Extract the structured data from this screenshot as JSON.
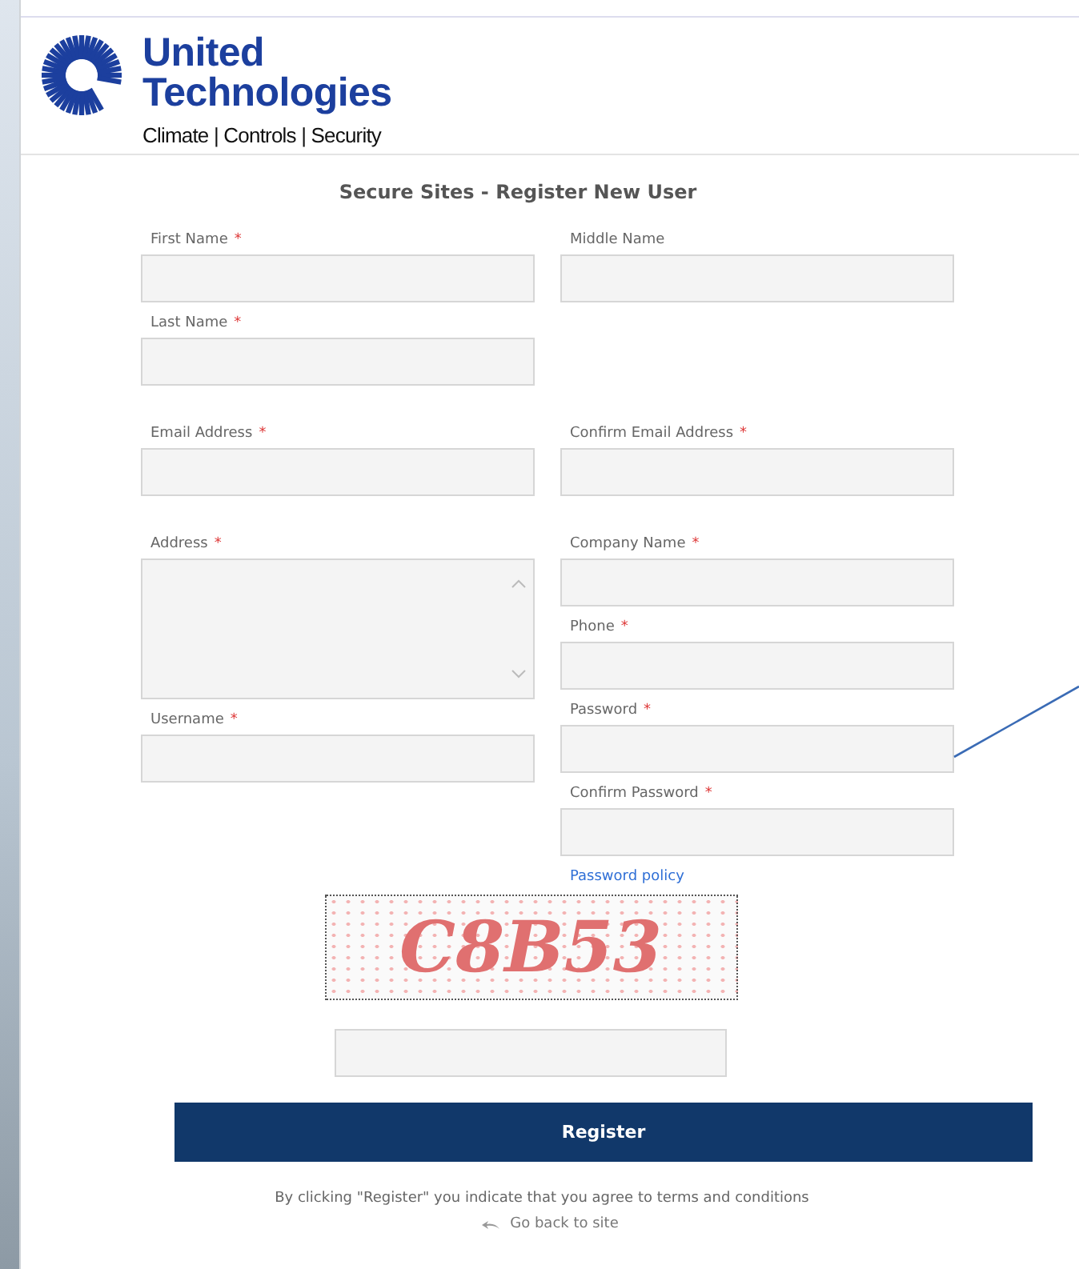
{
  "header": {
    "brand_line_1": "United",
    "brand_line_2": "Technologies",
    "tagline": "Climate | Controls | Security"
  },
  "form": {
    "title": "Secure Sites - Register New User",
    "sections": [
      {
        "left": [
          {
            "label": "First Name",
            "required_mark": "*",
            "kind": "text"
          },
          {
            "label": "Last Name",
            "required_mark": "*",
            "kind": "text"
          }
        ],
        "right": [
          {
            "label": "Middle Name",
            "kind": "text"
          }
        ]
      },
      {
        "left": [
          {
            "label": "Email Address",
            "required_mark": "*",
            "kind": "text"
          }
        ],
        "right": [
          {
            "label": "Confirm Email Address",
            "required_mark": "*",
            "kind": "text"
          }
        ]
      },
      {
        "left": [
          {
            "label": "Address",
            "required_mark": "*",
            "kind": "textarea"
          },
          {
            "label": "Username",
            "required_mark": "*",
            "kind": "text"
          }
        ],
        "right": [
          {
            "label": "Company Name",
            "required_mark": "*",
            "kind": "text"
          },
          {
            "label": "Phone",
            "required_mark": "*",
            "kind": "text"
          },
          {
            "label": "Password",
            "required_mark": "*",
            "kind": "text"
          },
          {
            "label": "Confirm Password",
            "required_mark": "*",
            "kind": "text"
          }
        ]
      }
    ],
    "policy_link": "Password policy",
    "captcha": "C8B53",
    "submit": "Register",
    "terms": "By clicking \"Register\" you indicate that you agree to terms and conditions",
    "back_link": "Go back to site"
  }
}
